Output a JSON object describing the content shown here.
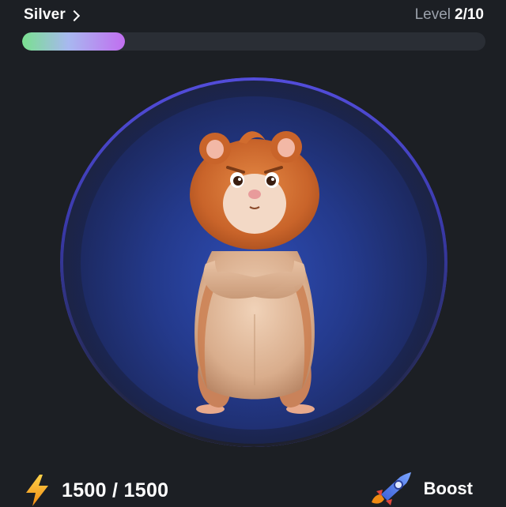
{
  "header": {
    "rank_label": "Silver",
    "level_label": "Level",
    "level_current": "2",
    "level_separator": "/",
    "level_max": "10"
  },
  "progress": {
    "fraction": 0.2213
  },
  "tap": {
    "character_icon": "hamster-character-icon"
  },
  "energy": {
    "icon": "lightning-bolt-icon",
    "text": "1500 / 1500"
  },
  "boost": {
    "icon": "rocket-icon",
    "label": "Boost"
  },
  "colors": {
    "background": "#1c1f24",
    "progress_start": "#79e08f",
    "progress_end": "#c16ef0",
    "ring": "#5650e4",
    "bolt": "#f7a51e"
  }
}
